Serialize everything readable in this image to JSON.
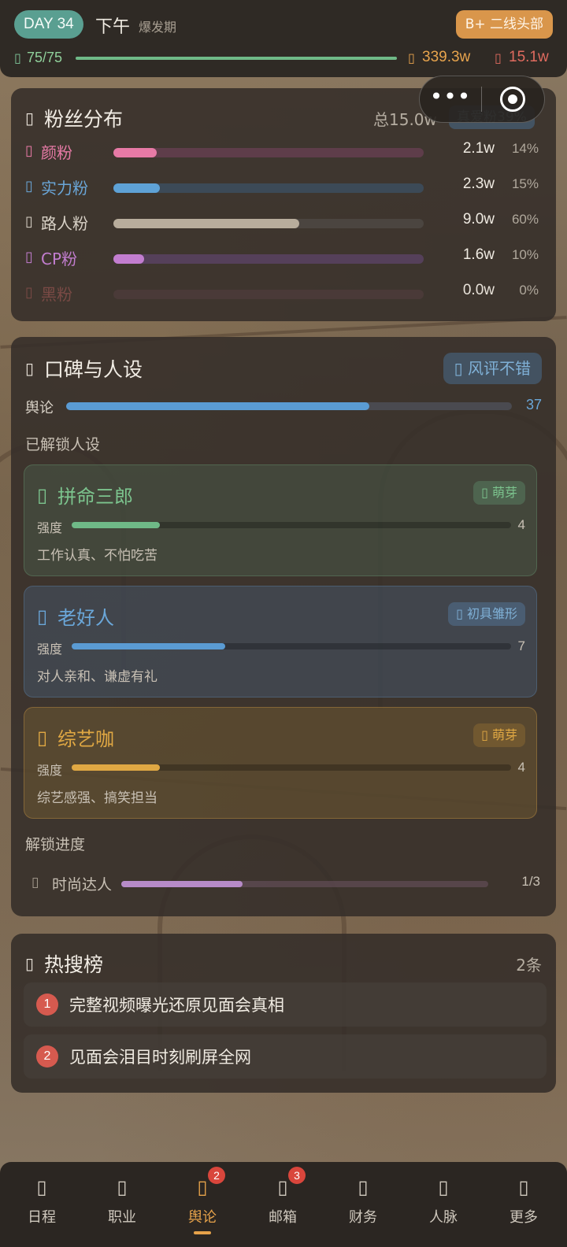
{
  "status": {
    "day": "DAY 34",
    "time": "下午",
    "phase": "爆发期",
    "rank": "B+ 二线头部",
    "energy": {
      "icon": "lightning-icon",
      "text": "75/75",
      "fraction": 1.0
    },
    "money": {
      "icon": "coin-icon",
      "text": "339.3w"
    },
    "fans": {
      "icon": "heart-icon",
      "text": "15.1w"
    }
  },
  "fans_card": {
    "icon": "users-icon",
    "title": "粉丝分布",
    "total": "总15.0w",
    "true_fans": "真爱粉39%",
    "rows": [
      {
        "icon": "sparkle-icon",
        "label": "颜粉",
        "value": "2.1w",
        "percent": "14%",
        "fraction": 0.14,
        "color": "#e77aa6",
        "track": "#5e3d4a",
        "label_color": "#e77aa6"
      },
      {
        "icon": "star-icon",
        "label": "实力粉",
        "value": "2.3w",
        "percent": "15%",
        "fraction": 0.15,
        "color": "#5ea2d6",
        "track": "#3c4a57",
        "label_color": "#6aa6d8"
      },
      {
        "icon": "person-icon",
        "label": "路人粉",
        "value": "9.0w",
        "percent": "60%",
        "fraction": 0.6,
        "color": "#b8ad9c",
        "track": "#4b4540",
        "label_color": "#d9d2c7"
      },
      {
        "icon": "couple-icon",
        "label": "CP粉",
        "value": "1.6w",
        "percent": "10%",
        "fraction": 0.1,
        "color": "#c27dcf",
        "track": "#55405a",
        "label_color": "#c27dcf"
      },
      {
        "icon": "skull-icon",
        "label": "黑粉",
        "value": "0.0w",
        "percent": "0%",
        "fraction": 0.0,
        "color": "#a04b4b",
        "track": "#4a3a38",
        "label_color": "#7a4a45"
      }
    ]
  },
  "rep_card": {
    "icon": "masks-icon",
    "title": "口碑与人设",
    "badge": "风评不错",
    "badge_icon": "thumbs-up-icon",
    "opinion_label": "舆论",
    "opinion_value": "37",
    "opinion_fraction": 0.68,
    "unlocked_label": "已解锁人设",
    "personas": [
      {
        "icon": "flame-icon",
        "name": "拼命三郎",
        "tag_icon": "sprout-icon",
        "tag": "萌芽",
        "strength_label": "强度",
        "strength": "4",
        "fraction": 0.2,
        "desc": "工作认真、不怕吃苦",
        "name_color": "#7cc48e",
        "fill": "#6fb987",
        "bg": "rgba(80,110,85,0.35)",
        "border": "rgba(110,160,120,0.35)",
        "tag_bg": "rgba(90,130,100,0.5)",
        "tag_color": "#7cc48e"
      },
      {
        "icon": "smile-icon",
        "name": "老好人",
        "tag_icon": "leaf-icon",
        "tag": "初具雏形",
        "strength_label": "强度",
        "strength": "7",
        "fraction": 0.35,
        "desc": "对人亲和、谦虚有礼",
        "name_color": "#6aa6d8",
        "fill": "#5a9bd3",
        "bg": "rgba(70,90,115,0.45)",
        "border": "rgba(100,140,180,0.35)",
        "tag_bg": "rgba(80,110,140,0.6)",
        "tag_color": "#7fb0d6"
      },
      {
        "icon": "mic-icon",
        "name": "综艺咖",
        "tag_icon": "sprout-icon",
        "tag": "萌芽",
        "strength_label": "强度",
        "strength": "4",
        "fraction": 0.2,
        "desc": "综艺感强、搞笑担当",
        "name_color": "#e0a843",
        "fill": "#e0a843",
        "bg": "rgba(120,95,50,0.45)",
        "border": "rgba(200,150,70,0.4)",
        "tag_bg": "rgba(130,100,50,0.6)",
        "tag_color": "#e0a843"
      }
    ],
    "progress_label": "解锁进度",
    "progress": {
      "icon": "lock-icon",
      "label": "时尚达人",
      "value": "1/3",
      "fraction": 0.33
    }
  },
  "hot_card": {
    "icon": "fire-icon",
    "title": "热搜榜",
    "count": "2条",
    "items": [
      {
        "rank": "1",
        "text": "完整视频曝光还原见面会真相"
      },
      {
        "rank": "2",
        "text": "见面会泪目时刻刷屏全网"
      }
    ]
  },
  "nav": [
    {
      "icon": "calendar-icon",
      "glyph": "▯",
      "label": "日程",
      "active": false,
      "badge": ""
    },
    {
      "icon": "briefcase-icon",
      "glyph": "▯",
      "label": "职业",
      "active": false,
      "badge": ""
    },
    {
      "icon": "megaphone-icon",
      "glyph": "▯",
      "label": "舆论",
      "active": true,
      "badge": "2"
    },
    {
      "icon": "mail-icon",
      "glyph": "▯",
      "label": "邮箱",
      "active": false,
      "badge": "3"
    },
    {
      "icon": "wallet-icon",
      "glyph": "▯",
      "label": "财务",
      "active": false,
      "badge": ""
    },
    {
      "icon": "contacts-icon",
      "glyph": "▯",
      "label": "人脉",
      "active": false,
      "badge": ""
    },
    {
      "icon": "more-icon",
      "glyph": "▯",
      "label": "更多",
      "active": false,
      "badge": ""
    }
  ]
}
